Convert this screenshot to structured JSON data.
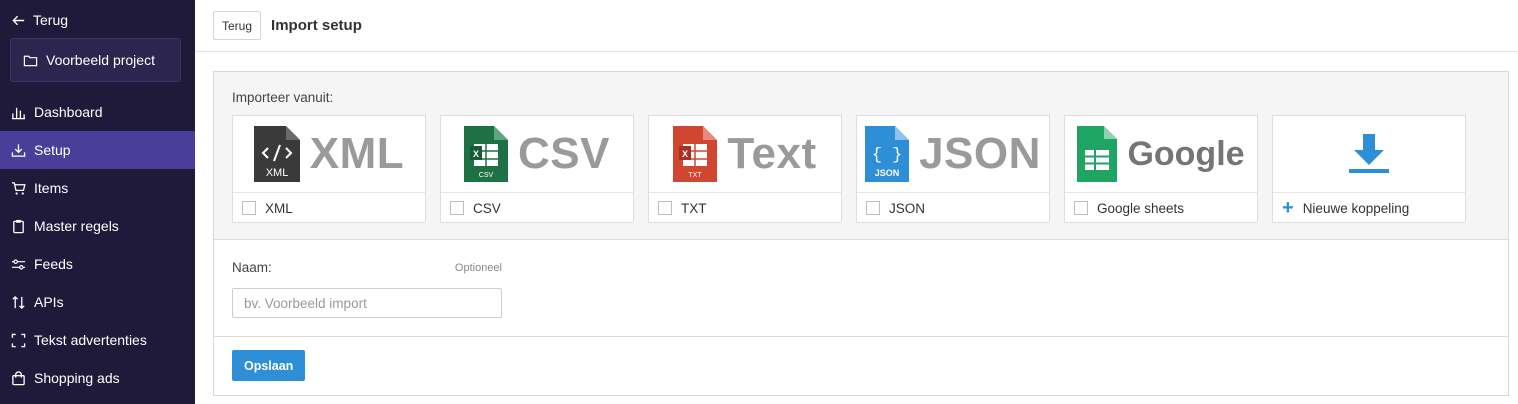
{
  "sidebar": {
    "back_label": "Terug",
    "project_name": "Voorbeeld project",
    "items": [
      {
        "label": "Dashboard",
        "icon": "chart-icon",
        "active": false
      },
      {
        "label": "Setup",
        "icon": "download-tray-icon",
        "active": true
      },
      {
        "label": "Items",
        "icon": "cart-icon",
        "active": false
      },
      {
        "label": "Master regels",
        "icon": "clipboard-icon",
        "active": false
      },
      {
        "label": "Feeds",
        "icon": "sliders-icon",
        "active": false
      },
      {
        "label": "APIs",
        "icon": "arrows-updown-icon",
        "active": false
      },
      {
        "label": "Tekst advertenties",
        "icon": "frame-icon",
        "active": false
      },
      {
        "label": "Shopping ads",
        "icon": "bag-icon",
        "active": false
      }
    ],
    "colors": {
      "background": "#1f1a3a",
      "active": "#4b3e9a"
    }
  },
  "header": {
    "back_button": "Terug",
    "title": "Import setup"
  },
  "import": {
    "label": "Importeer vanuit:",
    "sources": [
      {
        "logo_text": "XML",
        "file_label": "XML",
        "label": "XML",
        "icon": "xml-file-icon"
      },
      {
        "logo_text": "CSV",
        "file_label": "CSV",
        "label": "CSV",
        "icon": "csv-file-icon"
      },
      {
        "logo_text": "Text",
        "file_label": "TXT",
        "label": "TXT",
        "icon": "txt-file-icon"
      },
      {
        "logo_text": "JSON",
        "file_label": "JSON",
        "label": "JSON",
        "icon": "json-file-icon"
      },
      {
        "logo_text": "Google",
        "label": "Google sheets",
        "icon": "google-sheets-icon"
      },
      {
        "label": "Nieuwe koppeling",
        "icon": "download-icon"
      }
    ]
  },
  "form": {
    "name_label": "Naam:",
    "optional": "Optioneel",
    "name_placeholder": "bv. Voorbeeld import",
    "name_value": ""
  },
  "actions": {
    "save_label": "Opslaan",
    "accent": "#2e8fd6"
  }
}
